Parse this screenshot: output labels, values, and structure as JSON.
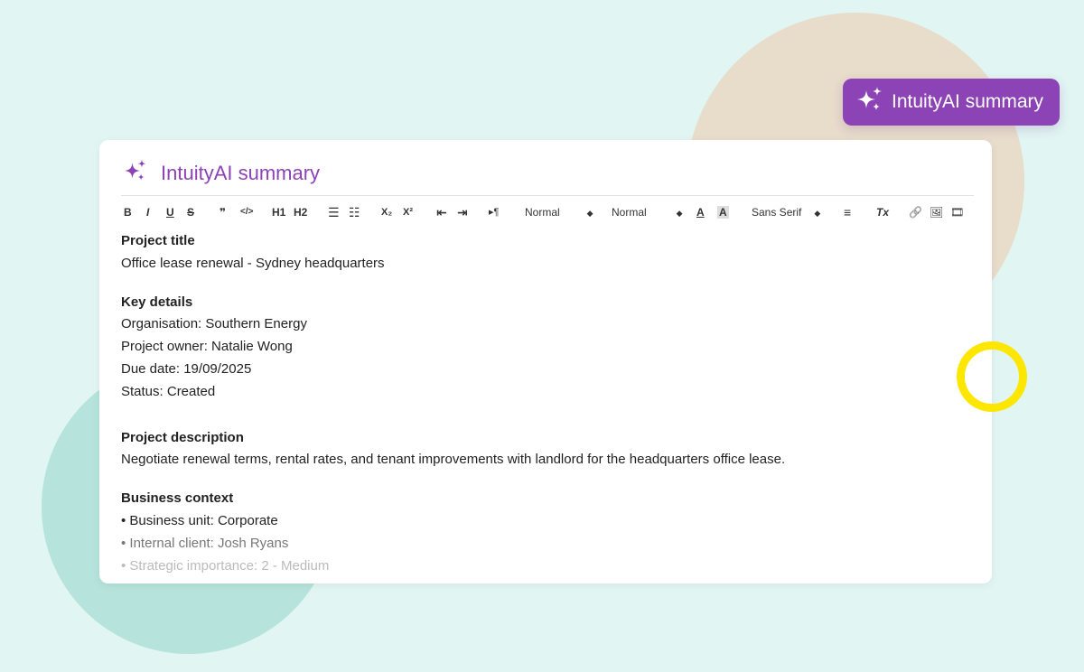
{
  "badge": {
    "label": "IntuityAI summary",
    "icon": "sparkle-icon"
  },
  "card": {
    "title": "IntuityAI summary",
    "icon": "sparkle-icon"
  },
  "toolbar": {
    "bold": "B",
    "italic": "I",
    "underline": "U",
    "strike": "S",
    "quote": "❞",
    "code": "</>",
    "h1": "H1",
    "h2": "H2",
    "ordered_list": "☰",
    "bullet_list": "☷",
    "subscript": "X₂",
    "superscript": "X²",
    "outdent": "⇤",
    "indent": "⇥",
    "direction": "▸¶",
    "size_select": "Normal",
    "header_select": "Normal",
    "font_color": "A",
    "bg_color": "A",
    "font_select": "Sans Serif",
    "align": "≡",
    "clean": "Tx",
    "link": "🔗",
    "image": "🖼",
    "video": "🎞"
  },
  "content": {
    "project_title_heading": "Project title",
    "project_title": "Office lease renewal - Sydney headquarters",
    "key_details_heading": "Key details",
    "organisation": "Organisation: Southern Energy",
    "owner": "Project owner: Natalie Wong",
    "due_date": "Due date: 19/09/2025",
    "status": "Status: Created",
    "description_heading": "Project description",
    "description": "Negotiate renewal terms, rental rates, and tenant improvements with landlord for the headquarters office lease.",
    "business_context_heading": "Business context",
    "business_unit": "• Business unit: Corporate",
    "internal_client": "• Internal client: Josh Ryans",
    "strategic_importance": "• Strategic importance: 2 - Medium"
  },
  "colors": {
    "accent": "#8c43b6",
    "background": "#e1f5f3",
    "highlight": "#fde600"
  }
}
